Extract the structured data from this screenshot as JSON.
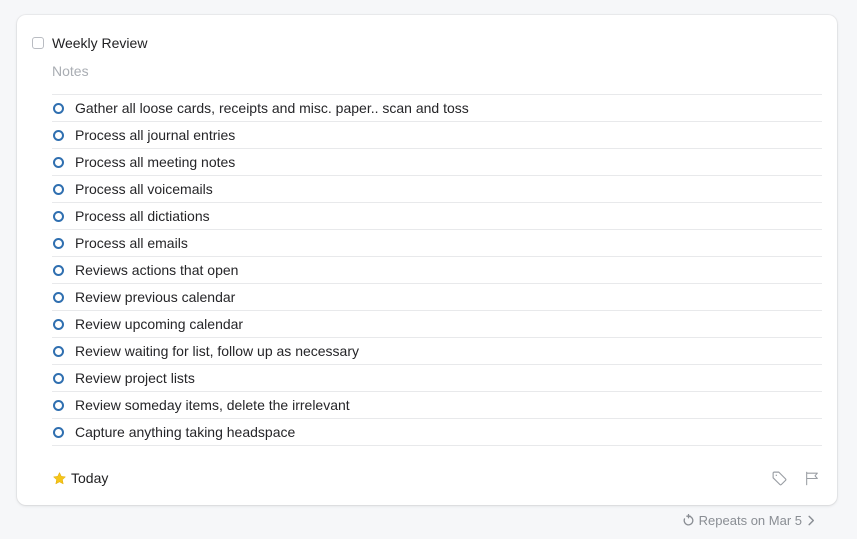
{
  "task": {
    "title": "Weekly Review",
    "notes_placeholder": "Notes",
    "completed": false
  },
  "checklist": [
    {
      "label": "Gather all loose cards, receipts and misc. paper.. scan and toss",
      "done": false
    },
    {
      "label": "Process all journal entries",
      "done": false
    },
    {
      "label": "Process all meeting notes",
      "done": false
    },
    {
      "label": "Process all voicemails",
      "done": false
    },
    {
      "label": "Process all dictiations",
      "done": false
    },
    {
      "label": "Process all emails",
      "done": false
    },
    {
      "label": "Reviews actions that open",
      "done": false
    },
    {
      "label": "Review previous calendar",
      "done": false
    },
    {
      "label": "Review upcoming calendar",
      "done": false
    },
    {
      "label": "Review waiting for list, follow up as necessary",
      "done": false
    },
    {
      "label": "Review project lists",
      "done": false
    },
    {
      "label": "Review someday items, delete the irrelevant",
      "done": false
    },
    {
      "label": "Capture anything taking headspace",
      "done": false
    }
  ],
  "footer": {
    "when_icon": "star-icon",
    "when_label": "Today",
    "tag_icon": "tag-icon",
    "flag_icon": "flag-icon"
  },
  "repeat": {
    "icon": "repeat-icon",
    "label": "Repeats on Mar 5",
    "chevron": "chevron-right-icon"
  },
  "colors": {
    "checklist_circle": "#2f6fb0",
    "star": "#f5c518",
    "background": "#f6f7f9"
  }
}
